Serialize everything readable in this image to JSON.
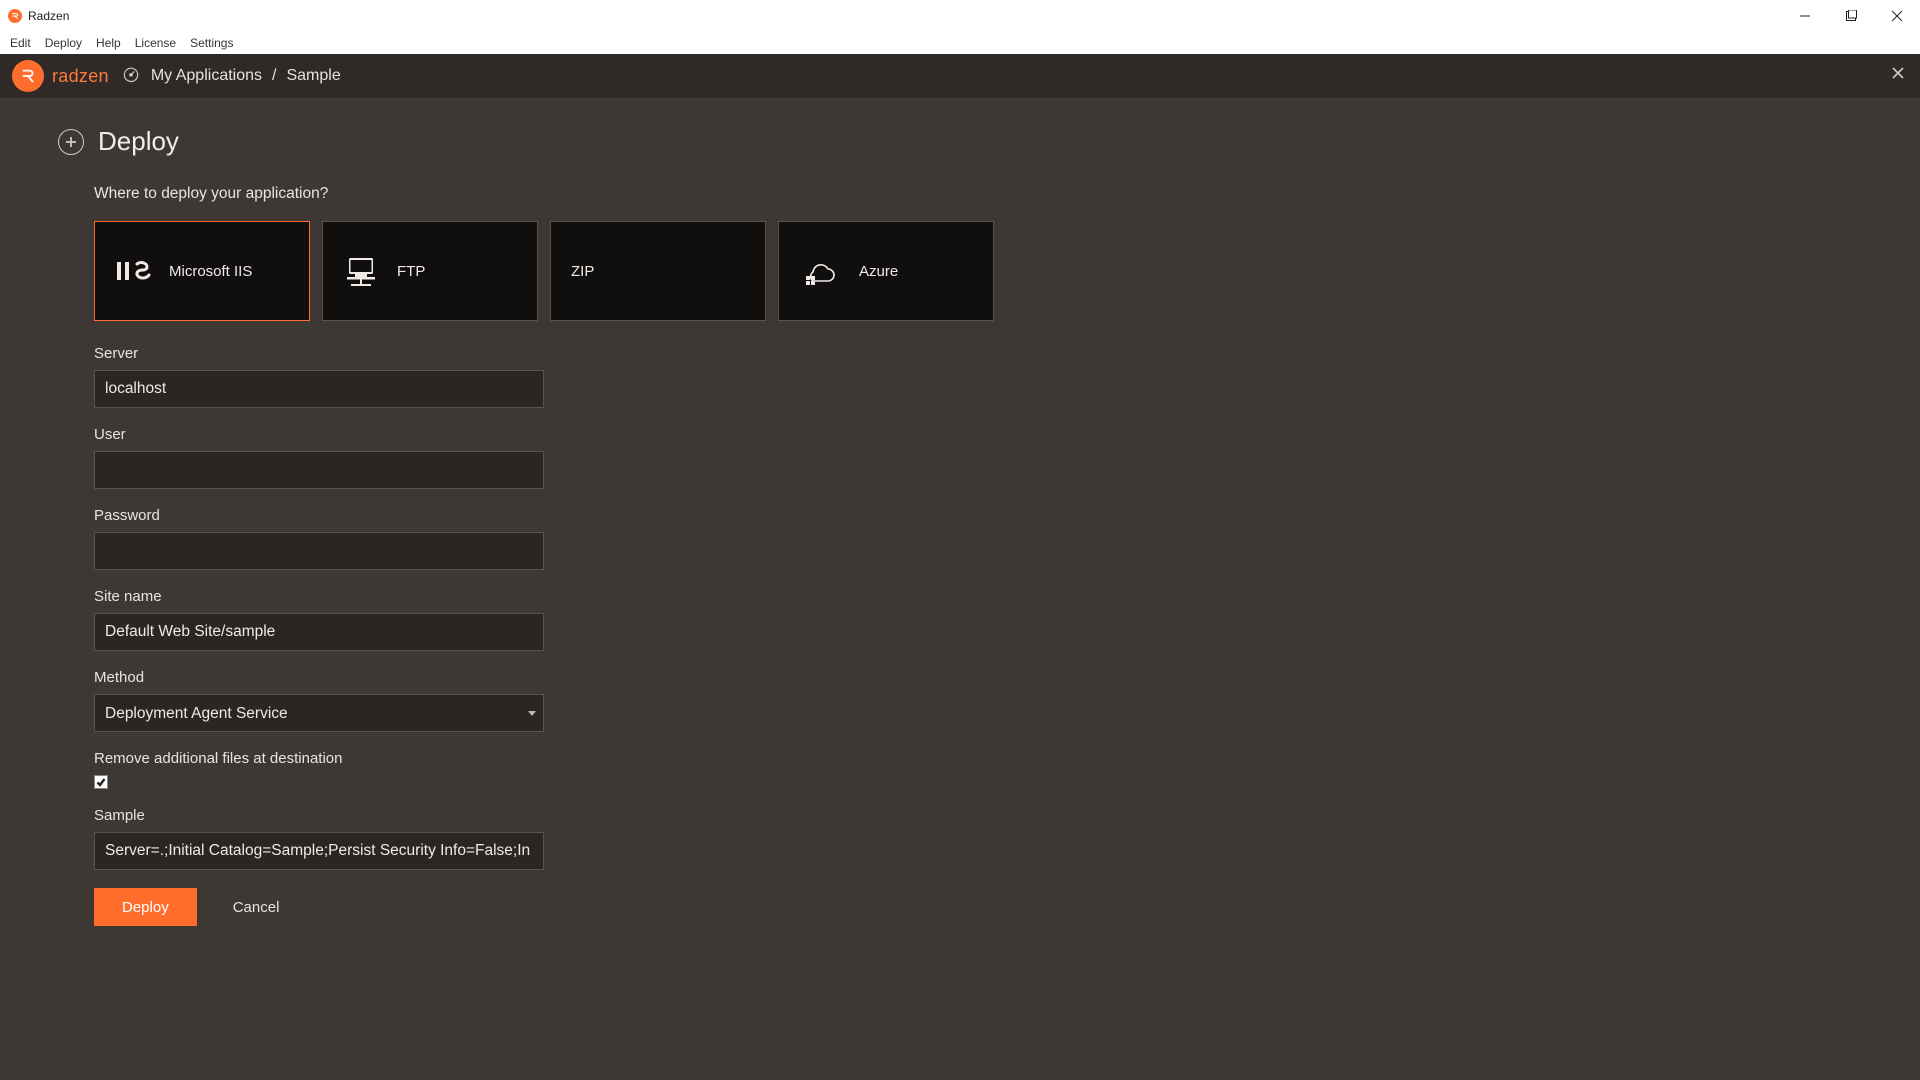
{
  "window": {
    "title": "Radzen",
    "menu": [
      "Edit",
      "Deploy",
      "Help",
      "License",
      "Settings"
    ]
  },
  "brand": {
    "name": "radzen"
  },
  "breadcrumb": {
    "root": "My Applications",
    "current": "Sample"
  },
  "page": {
    "title": "Deploy",
    "prompt": "Where to deploy your application?"
  },
  "targets": [
    {
      "id": "iis",
      "label": "Microsoft IIS",
      "selected": true
    },
    {
      "id": "ftp",
      "label": "FTP",
      "selected": false
    },
    {
      "id": "zip",
      "label": "ZIP",
      "selected": false
    },
    {
      "id": "azure",
      "label": "Azure",
      "selected": false
    }
  ],
  "form": {
    "server_label": "Server",
    "server_value": "localhost",
    "user_label": "User",
    "user_value": "",
    "password_label": "Password",
    "password_value": "",
    "sitename_label": "Site name",
    "sitename_value": "Default Web Site/sample",
    "method_label": "Method",
    "method_value": "Deployment Agent Service",
    "method_options": [
      "Deployment Agent Service"
    ],
    "remove_label": "Remove additional files at destination",
    "remove_checked": true,
    "sample_label": "Sample",
    "sample_value": "Server=.;Initial Catalog=Sample;Persist Security Info=False;In"
  },
  "actions": {
    "primary": "Deploy",
    "secondary": "Cancel"
  },
  "colors": {
    "accent": "#ff6d2d",
    "bg": "#3e3835",
    "card": "#110f0e"
  }
}
